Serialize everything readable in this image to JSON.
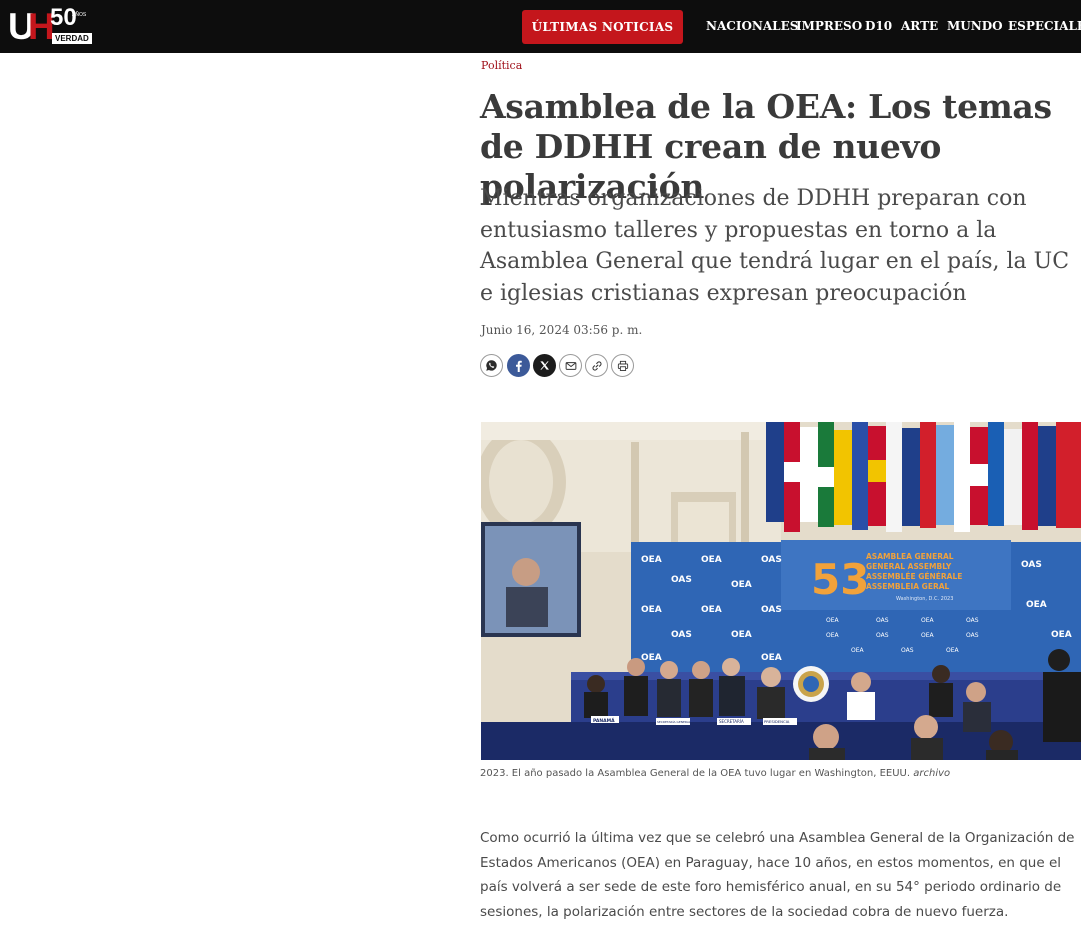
{
  "brand": {
    "logo_u": "U",
    "logo_h": "H",
    "logo_years": "50",
    "logo_years_word": "AÑOS",
    "logo_tagline": "VERDAD",
    "red": "#c4161c",
    "dark": "#0d0d0d"
  },
  "header": {
    "breaking_label": "ÚLTIMAS NOTICIAS",
    "nav": [
      "NACIONALES",
      "IMPRESO",
      "D10",
      "ARTE",
      "MUNDO",
      "ESPECIALES"
    ]
  },
  "article": {
    "category": "Política",
    "headline": "Asamblea de la OEA: Los temas de DDHH crean de nuevo polarización",
    "subtitle": "Mientras organizaciones de DDHH preparan con entusiasmo talleres y propuestas en torno a la Asamblea General que tendrá lugar en el país, la UC e iglesias cristianas expresan preocupación",
    "date": "Junio 16, 2024 03:56 p. m.",
    "share_icons": [
      "whatsapp-icon",
      "facebook-icon",
      "x-icon",
      "mail-icon",
      "link-icon",
      "print-icon"
    ],
    "photo": {
      "banner_number": "53",
      "banner_lines": [
        "ASAMBLEA GENERAL",
        "GENERAL ASSEMBLY",
        "ASSEMBLÉE GÉNÉRALE",
        "ASSEMBLEIA GERAL"
      ],
      "banner_place": "Washington, D.C. 2023",
      "oas_logo_text": [
        "OEA",
        "OAS"
      ],
      "nameplates": [
        "PANAMÁ",
        "SECRETARÍA GENERAL",
        "SECRETARÍA",
        "PRESIDENCIA"
      ]
    },
    "caption_text": "2023. El año pasado la Asamblea General de la OEA tuvo lugar en Washington, EEUU.",
    "caption_credit": "archivo",
    "body": "Como ocurrió la última vez que se celebró una Asamblea General de la Organización de Estados Americanos (OEA) en Paraguay, hace 10 años, en estos momentos, en que el país volverá a ser sede de este foro hemisférico anual, en su 54° periodo ordinario de sesiones, la polarización entre sectores de la sociedad cobra de nuevo fuerza."
  }
}
